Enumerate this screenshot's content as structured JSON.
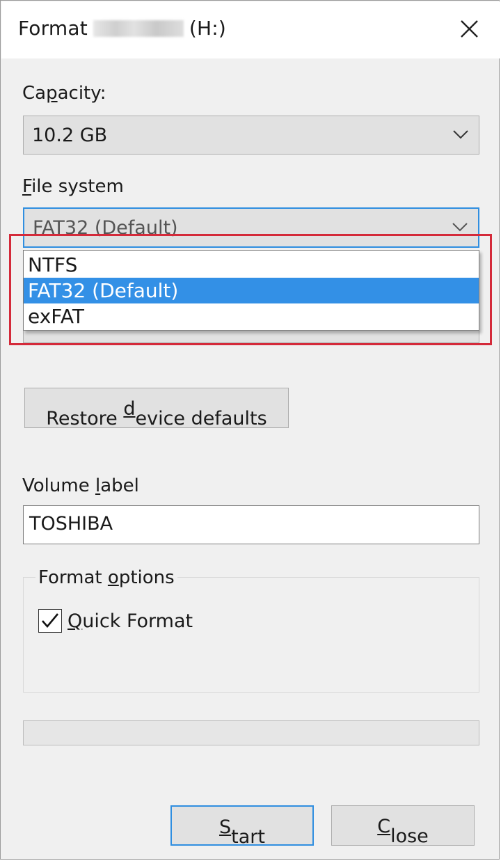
{
  "window": {
    "title_prefix": "Format",
    "drive_letter": "(H:)"
  },
  "capacity": {
    "label_pre": "Ca",
    "label_ul": "p",
    "label_post": "acity:",
    "value": "10.2 GB"
  },
  "file_system": {
    "label_ul": "F",
    "label_post": "ile system",
    "value": "FAT32 (Default)",
    "options": [
      "NTFS",
      "FAT32 (Default)",
      "exFAT"
    ],
    "selected_index": 1
  },
  "restore_button": {
    "label_pre": "Restore ",
    "label_ul": "d",
    "label_post": "evice defaults"
  },
  "volume_label": {
    "label_pre": "Volume ",
    "label_ul": "l",
    "label_post": "abel",
    "value": "TOSHIBA"
  },
  "format_options": {
    "legend_pre": "Format ",
    "legend_ul": "o",
    "legend_post": "ptions",
    "quick_format": {
      "label_ul": "Q",
      "label_post": "uick Format",
      "checked": true
    }
  },
  "progress": {
    "value": 0
  },
  "buttons": {
    "start_ul": "S",
    "start_post": "tart",
    "close_ul": "C",
    "close_post": "lose"
  },
  "colors": {
    "selection": "#3390e6",
    "focus_border": "#2f8ee0",
    "highlight_box": "#d42a3a"
  },
  "icons": {
    "close": "close-icon",
    "dropdown": "chevron-down-icon",
    "check": "checkmark-icon"
  }
}
